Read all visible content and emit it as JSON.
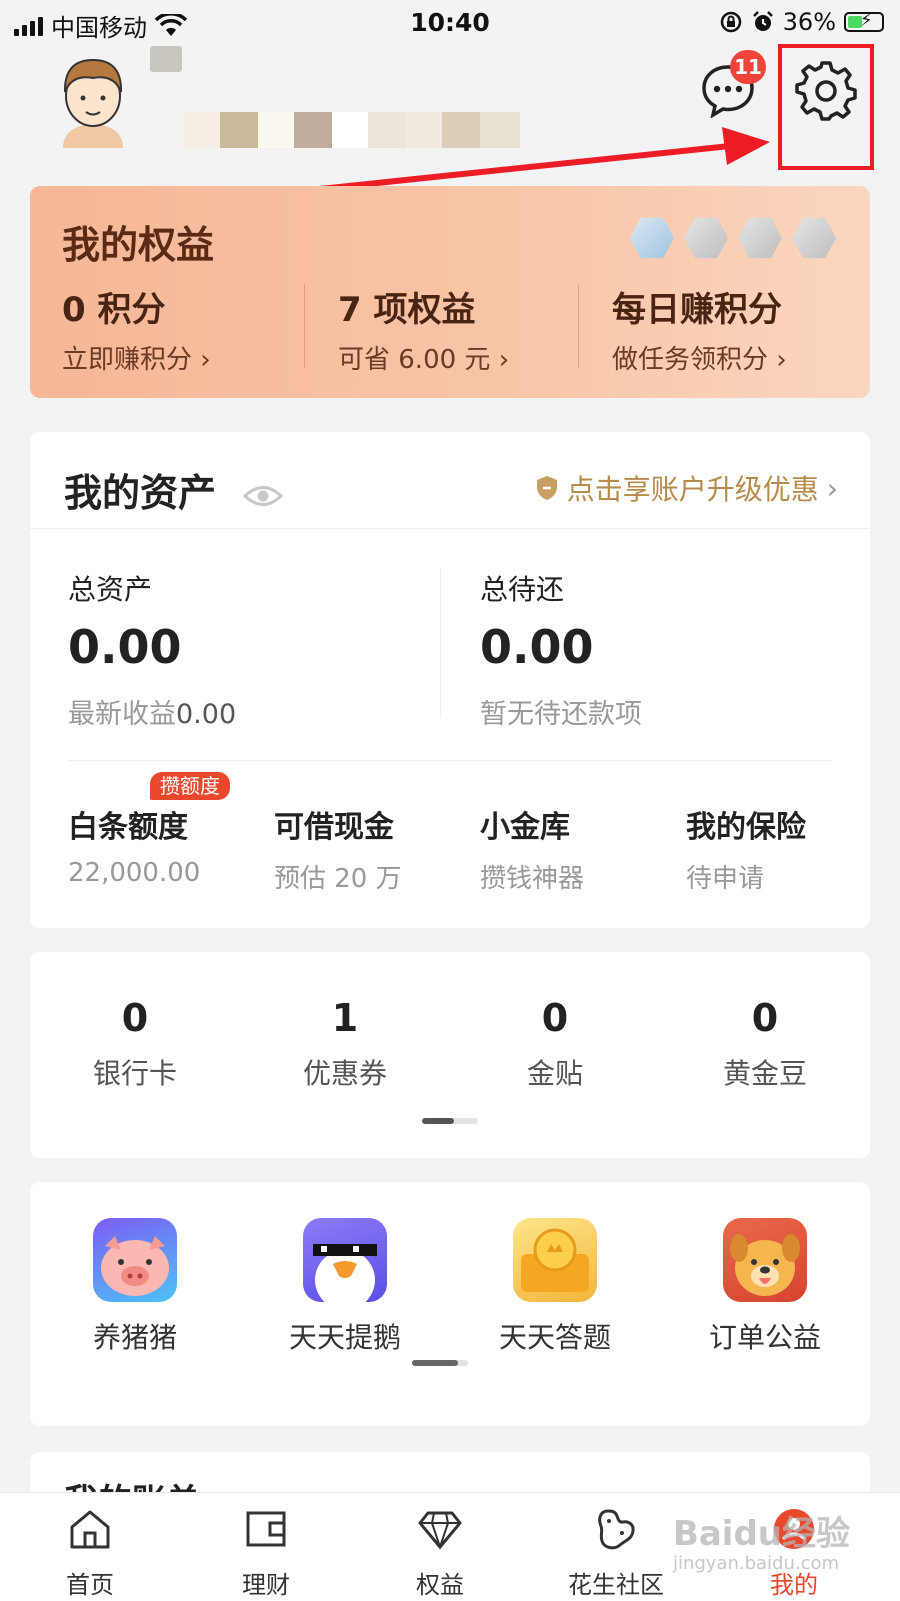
{
  "status_bar": {
    "carrier": "中国移动",
    "time": "10:40",
    "battery": "36%"
  },
  "header": {
    "message_badge": "11"
  },
  "benefits": {
    "title": "我的权益",
    "columns": [
      {
        "main": "0 积分",
        "sub": "立即赚积分"
      },
      {
        "main": "7 项权益",
        "sub": "可省 6.00 元"
      },
      {
        "main": "每日赚积分",
        "sub": "做任务领积分"
      }
    ]
  },
  "assets": {
    "title": "我的资产",
    "promo": "点击享账户升级优惠",
    "total_label": "总资产",
    "total_value": "0.00",
    "earnings_label": "最新收益",
    "earnings_value": "0.00",
    "repay_label": "总待还",
    "repay_value": "0.00",
    "repay_sub": "暂无待还款项",
    "quick": [
      {
        "title": "白条额度",
        "sub": "22,000.00",
        "tag": "攒额度"
      },
      {
        "title": "可借现金",
        "sub": "预估 20 万"
      },
      {
        "title": "小金库",
        "sub": "攒钱神器"
      },
      {
        "title": "我的保险",
        "sub": "待申请"
      }
    ]
  },
  "counts": [
    {
      "value": "0",
      "label": "银行卡"
    },
    {
      "value": "1",
      "label": "优惠券"
    },
    {
      "value": "0",
      "label": "金贴"
    },
    {
      "value": "0",
      "label": "黄金豆"
    }
  ],
  "games": [
    {
      "label": "养猪猪",
      "icon": "pig-icon"
    },
    {
      "label": "天天提鹅",
      "icon": "goose-icon"
    },
    {
      "label": "天天答题",
      "icon": "quiz-coin-icon"
    },
    {
      "label": "订单公益",
      "icon": "dog-icon"
    }
  ],
  "bill_section": {
    "title": "我的账单"
  },
  "tabs": [
    {
      "label": "首页",
      "icon": "home-icon",
      "active": false
    },
    {
      "label": "理财",
      "icon": "wallet-icon",
      "active": false
    },
    {
      "label": "权益",
      "icon": "diamond-icon",
      "active": false
    },
    {
      "label": "花生社区",
      "icon": "peanut-icon",
      "active": false
    },
    {
      "label": "我的",
      "icon": "profile-icon",
      "active": true
    }
  ],
  "watermark": {
    "main": "Baidu经验",
    "sub": "jingyan.baidu.com"
  },
  "colors": {
    "accent_red": "#e9482d",
    "highlight_box": "#ee1c25",
    "gold": "#b68b4c"
  }
}
